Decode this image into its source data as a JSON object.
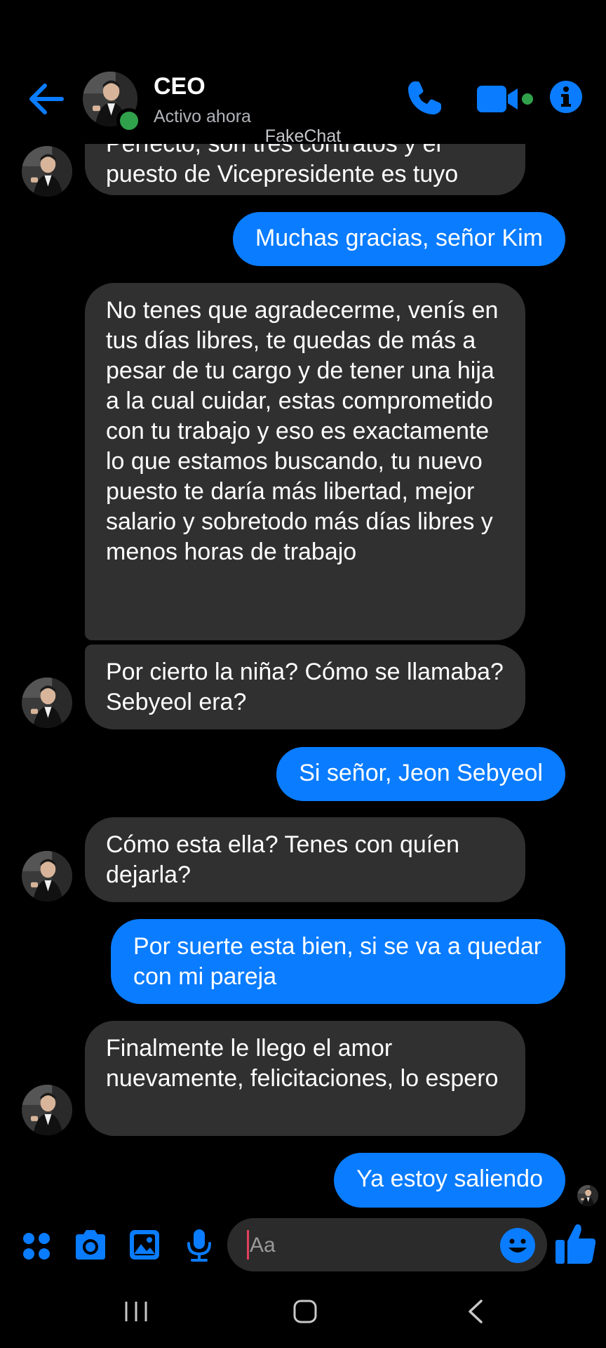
{
  "header": {
    "contact_name": "CEO",
    "status": "Activo ahora",
    "watermark": "FakeChat",
    "accent_color": "#0a7cff",
    "online_color": "#31a24c",
    "icons": [
      "back-arrow-icon",
      "phone-icon",
      "video-camera-icon",
      "info-icon"
    ]
  },
  "messages": [
    {
      "from": "them",
      "text": "Perfecto, son tres contratos y el puesto de Vicepresidente es tuyo"
    },
    {
      "from": "me",
      "text": "Muchas gracias, señor Kim"
    },
    {
      "from": "them",
      "text": "No tenes que agradecerme, venís en tus días libres, te quedas de más a pesar de tu cargo y de tener una hija a la cual cuidar, estas comprometido con tu trabajo y eso es exactamente lo que estamos buscando, tu nuevo puesto te daría más libertad, mejor salario y sobretodo más días libres y menos horas de trabajo"
    },
    {
      "from": "them",
      "text": "Por cierto la niña? Cómo se llamaba? Sebyeol era?"
    },
    {
      "from": "me",
      "text": "Si señor, Jeon Sebyeol"
    },
    {
      "from": "them",
      "text": "Cómo esta ella? Tenes con quíen dejarla?"
    },
    {
      "from": "me",
      "text": "Por suerte esta bien, si se va a quedar con mi pareja"
    },
    {
      "from": "them",
      "text": "Finalmente le llego el amor nuevamente, felicitaciones, lo espero"
    },
    {
      "from": "me",
      "text": "Ya estoy saliendo"
    }
  ],
  "composer": {
    "placeholder": "Aa",
    "icons": [
      "apps-grid-icon",
      "camera-icon",
      "gallery-icon",
      "microphone-icon",
      "emoji-icon",
      "thumbs-up-icon"
    ]
  },
  "navbar": {
    "icons": [
      "recent-apps-icon",
      "home-icon",
      "back-nav-icon"
    ]
  }
}
